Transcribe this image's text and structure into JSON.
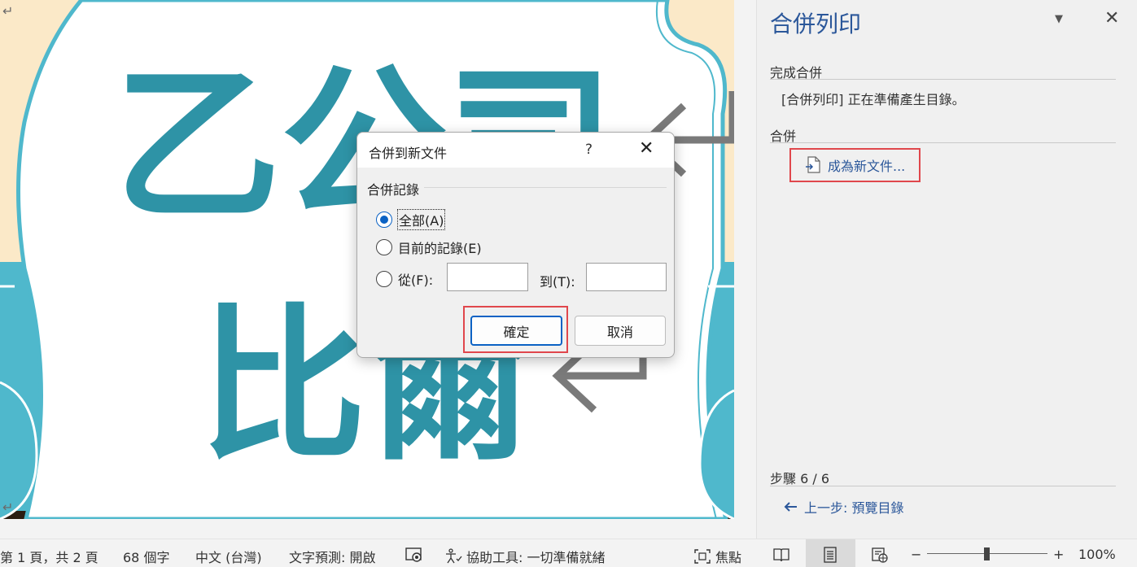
{
  "document": {
    "headline_line1": "乙公司",
    "headline_line2": "比爾"
  },
  "task_pane": {
    "title": "合併列印",
    "section_complete": "完成合併",
    "status_message": "[合併列印] 正在準備產生目錄。",
    "section_merge": "合併",
    "merge_link_label": "成為新文件...",
    "step_label": "步驟 6 / 6",
    "prev_step_label": "上一步: 預覽目錄"
  },
  "dialog": {
    "title": "合併到新文件",
    "help": "?",
    "group_label": "合併記錄",
    "options": [
      {
        "label": "全部(A)",
        "selected": true
      },
      {
        "label": "目前的記錄(E)",
        "selected": false
      },
      {
        "label": "從(F):",
        "selected": false
      }
    ],
    "from_value": "",
    "to_label": "到(T):",
    "to_value": "",
    "ok_label": "確定",
    "cancel_label": "取消"
  },
  "status_bar": {
    "page": "第 1 頁，共 2 頁",
    "words": "68 個字",
    "language": "中文 (台灣)",
    "text_prediction": "文字預測: 開啟",
    "accessibility": "協助工具: 一切準備就緒",
    "focus": "焦點",
    "zoom_minus": "−",
    "zoom_plus": "+",
    "zoom_level": "100%"
  },
  "colors": {
    "accent": "#2b579a",
    "highlight": "#e0474c",
    "teal_text": "#2e93a6",
    "teal_band": "#4fb8cc",
    "cream": "#fbe9c8"
  }
}
